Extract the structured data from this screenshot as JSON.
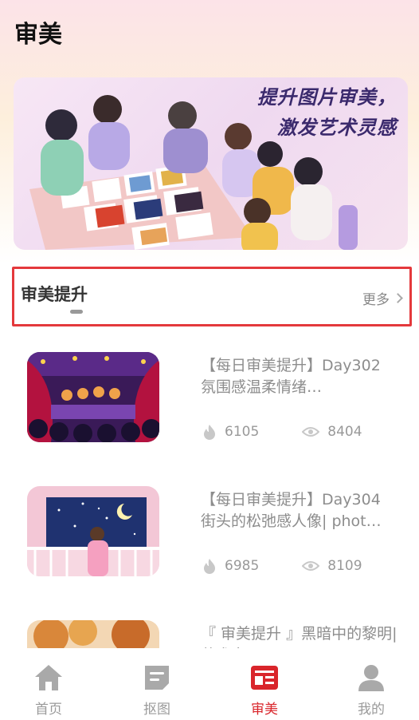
{
  "header": {
    "title": "审美"
  },
  "banner": {
    "line1": "提升图片审美，",
    "line2": "激发艺术灵感"
  },
  "section": {
    "title": "审美提升",
    "more_label": "更多"
  },
  "articles": [
    {
      "title": "【每日审美提升】Day302 氛围感温柔情绪…",
      "likes": "6105",
      "views": "8404"
    },
    {
      "title": "【每日审美提升】Day304 街头的松弛感人像| phot…",
      "likes": "6985",
      "views": "8109"
    },
    {
      "title": "『 审美提升 』黑暗中的黎明| 艺术家Shaun Tan",
      "likes": "",
      "views": ""
    }
  ],
  "tabbar": {
    "tabs": [
      {
        "label": "首页",
        "icon": "home-icon"
      },
      {
        "label": "抠图",
        "icon": "cutout-icon"
      },
      {
        "label": "审美",
        "icon": "aesthetics-icon"
      },
      {
        "label": "我的",
        "icon": "profile-icon"
      }
    ],
    "active_color": "#d9252b",
    "inactive_color": "#9a9a9a"
  }
}
